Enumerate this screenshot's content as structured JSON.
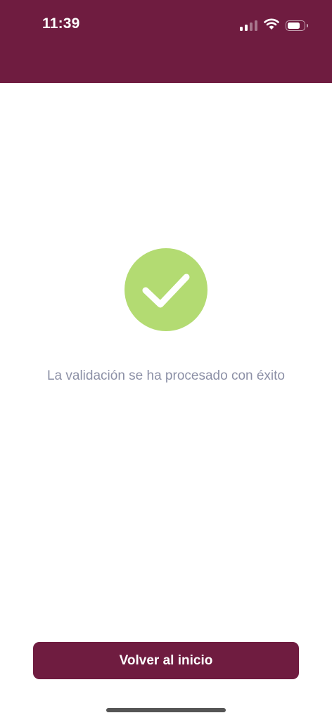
{
  "status_bar": {
    "time": "11:39",
    "icons": [
      "signal-icon",
      "wifi-icon",
      "battery-icon"
    ],
    "signal_bars_active": 2,
    "signal_bars_total": 4,
    "battery_level": 0.75
  },
  "colors": {
    "brand": "#6f1c40",
    "success": "#b3db72",
    "message_text": "#8c90a6",
    "background": "#ffffff"
  },
  "result": {
    "icon": "checkmark-icon",
    "message": "La validación se ha procesado con éxito"
  },
  "actions": {
    "back_home_label": "Volver al inicio"
  }
}
